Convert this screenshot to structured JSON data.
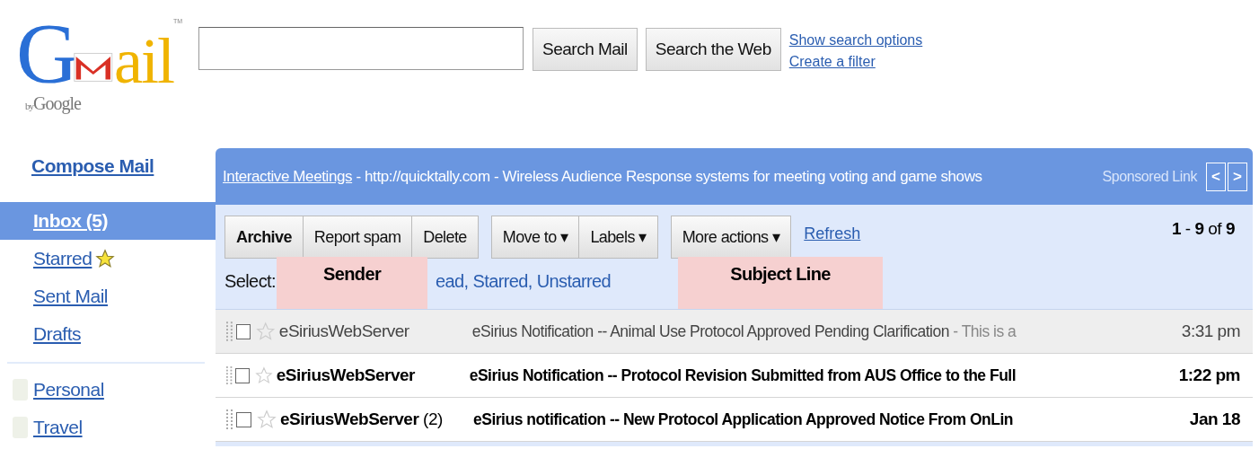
{
  "logo": {
    "before": "G",
    "after": "ail",
    "trademark": "TM",
    "by": "by",
    "brand": "Google"
  },
  "search": {
    "buttons": [
      "Search Mail",
      "Search the Web"
    ],
    "links": [
      "Show search options",
      "Create a filter"
    ]
  },
  "sidebar": {
    "compose": "Compose Mail",
    "items": [
      {
        "label": "Inbox (5)",
        "selected": true,
        "starred_icon": false
      },
      {
        "label": "Starred",
        "selected": false,
        "starred_icon": true
      },
      {
        "label": "Sent Mail",
        "selected": false,
        "starred_icon": false
      },
      {
        "label": "Drafts",
        "selected": false,
        "starred_icon": false
      }
    ],
    "labels": [
      {
        "label": "Personal",
        "color": "#eef1e8"
      },
      {
        "label": "Travel",
        "color": "#eef1e8"
      }
    ]
  },
  "ad": {
    "link": "Interactive Meetings",
    "text": " - http://quicktally.com - Wireless Audience Response systems for meeting voting and game shows",
    "sponsored": "Sponsored Link",
    "prev": "<",
    "next": ">"
  },
  "toolbar": {
    "groups": [
      [
        {
          "label": "Archive",
          "bold": true
        },
        {
          "label": "Report spam",
          "bold": false
        },
        {
          "label": "Delete",
          "bold": false
        }
      ],
      [
        {
          "label": "Move to ▾",
          "bold": false
        },
        {
          "label": "Labels ▾",
          "bold": false
        }
      ],
      [
        {
          "label": "More actions ▾",
          "bold": false
        }
      ]
    ],
    "refresh": "Refresh",
    "count": "**1** - **9** of **9**",
    "select_label": "Select:",
    "select_links": "ead, Starred, Unstarred"
  },
  "annotations": [
    {
      "text": "Sender",
      "kind": "sender"
    },
    {
      "text": "Subject Line",
      "kind": "subject"
    }
  ],
  "rows": [
    {
      "sender": "eSiriusWebServer",
      "count": "",
      "subject": "eSirius Notification -- Animal Use Protocol Approved Pending Clarification",
      "snippet": " - This is a",
      "time": "3:31 pm",
      "unread": false,
      "checked": false,
      "starred": false
    },
    {
      "sender": "eSiriusWebServer",
      "count": "",
      "subject": "eSirius Notification -- Protocol Revision Submitted from AUS Office to the Full",
      "snippet": "",
      "time": "1:22 pm",
      "unread": true,
      "checked": false,
      "starred": false
    },
    {
      "sender": "eSiriusWebServer",
      "count": " (2)",
      "subject": "eSirius notification -- New Protocol Application Approved Notice From OnLin",
      "snippet": "",
      "time": "Jan 18",
      "unread": true,
      "checked": false,
      "starred": false
    }
  ]
}
